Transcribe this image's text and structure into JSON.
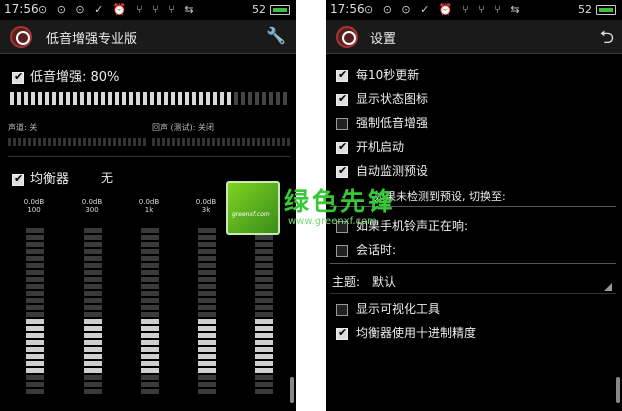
{
  "status_bar": {
    "time": "17:56",
    "icons": "⊙ ⊙ ⊙ ✓ ⏰ ⑂ ⑂ ⑂ ⇆",
    "battery": "52"
  },
  "left_app": {
    "title": "低音增强专业版",
    "bass_label": "低音增强: 80%",
    "bass_level": 0.8,
    "channel_label": "声道: 关",
    "echo_label": "回声 (测试): 关闭",
    "eq_label": "均衡器",
    "eq_preset": "无",
    "bands": [
      {
        "gain": "0.0dB",
        "freq": "100"
      },
      {
        "gain": "0.0dB",
        "freq": "300"
      },
      {
        "gain": "0.0dB",
        "freq": "1k"
      },
      {
        "gain": "0.0dB",
        "freq": "3k"
      },
      {
        "gain": "0.0dB",
        "freq": "10k"
      }
    ]
  },
  "right_app": {
    "title": "设置",
    "items": [
      {
        "label": "每10秒更新",
        "checked": true
      },
      {
        "label": "显示状态图标",
        "checked": true
      },
      {
        "label": "强制低音增强",
        "checked": false
      },
      {
        "label": "开机启动",
        "checked": true
      },
      {
        "label": "自动监测预设",
        "checked": true
      }
    ],
    "fallback_text": "如果未检测到预设, 切换至:",
    "ringing_label": "如果手机铃声正在响:",
    "call_label": "会话时:",
    "theme_label": "主题:",
    "theme_value": "默认",
    "show_visualizer": "显示可视化工具",
    "decimal_eq": "均衡器使用十进制精度"
  },
  "watermark": {
    "logo_text": "greenxf.com",
    "site_name": "绿色先锋",
    "url": "www.greenxf.com"
  }
}
